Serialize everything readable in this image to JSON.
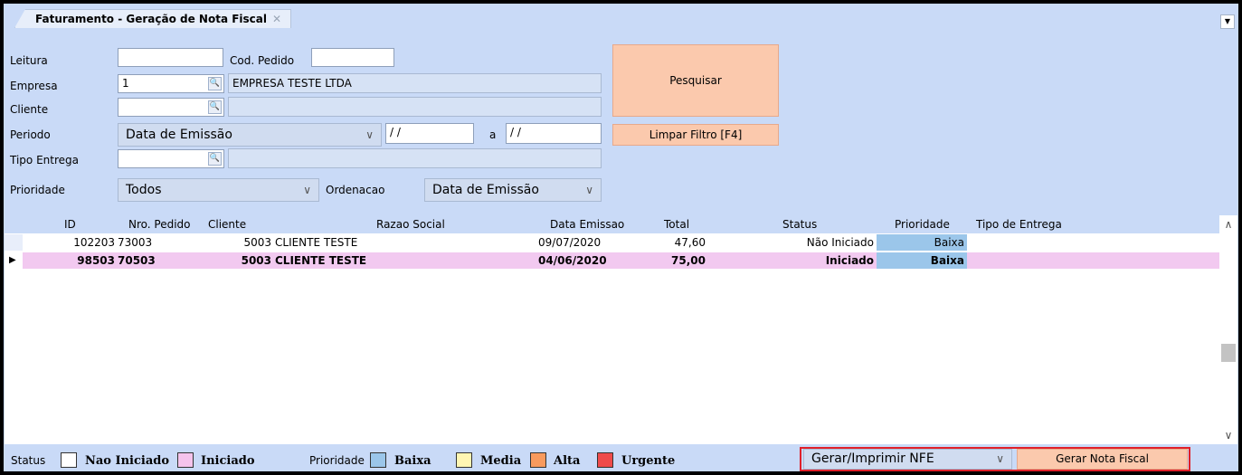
{
  "window": {
    "tab_title": "Faturamento - Geração de Nota Fiscal",
    "tab_close": "✕",
    "corner_glyph": "▼"
  },
  "filters": {
    "leitura_label": "Leitura",
    "leitura_value": "",
    "cod_pedido_label": "Cod. Pedido",
    "cod_pedido_value": "",
    "empresa_label": "Empresa",
    "empresa_code": "1",
    "empresa_name": "EMPRESA TESTE LTDA",
    "cliente_label": "Cliente",
    "cliente_code": "",
    "cliente_name": "",
    "periodo_label": "Periodo",
    "periodo_selected": "Data de Emissão",
    "date_from": " / /",
    "date_sep": "a",
    "date_to": " / /",
    "tipo_entrega_label": "Tipo Entrega",
    "tipo_entrega_code": "",
    "tipo_entrega_name": "",
    "prioridade_label": "Prioridade",
    "prioridade_selected": "Todos",
    "ordenacao_label": "Ordenacao",
    "ordenacao_selected": "Data de Emissão",
    "lens_glyph": "🔍",
    "dropdown_glyph": "∨"
  },
  "buttons": {
    "pesquisar": "Pesquisar",
    "limpar_filtro": "Limpar Filtro [F4]",
    "gerar_nota": "Gerar Nota Fiscal"
  },
  "grid": {
    "columns": [
      "ID",
      "Nro. Pedido",
      "Cliente",
      "Razao Social",
      "Data Emissao",
      "Total",
      "Status",
      "Prioridade",
      "Tipo de Entrega"
    ],
    "rows": [
      {
        "id": "102203",
        "nro_pedido": "73003",
        "cliente": "5003",
        "razao_social": "CLIENTE TESTE",
        "data_emissao": "09/07/2020",
        "total": "47,60",
        "status": "Não Iniciado",
        "prioridade": "Baixa",
        "tipo_entrega": ""
      },
      {
        "id": "98503",
        "nro_pedido": "70503",
        "cliente": "5003",
        "razao_social": "CLIENTE TESTE",
        "data_emissao": "04/06/2020",
        "total": "75,00",
        "status": "Iniciado",
        "prioridade": "Baixa",
        "tipo_entrega": ""
      }
    ],
    "selected_marker": "▶",
    "scroll_up": "∧",
    "scroll_down": "∨"
  },
  "legend": {
    "status_label": "Status",
    "nao_iniciado": "Nao Iniciado",
    "iniciado": "Iniciado",
    "prioridade_label": "Prioridade",
    "baixa": "Baixa",
    "media": "Media",
    "alta": "Alta",
    "urgente": "Urgente"
  },
  "action": {
    "selected": "Gerar/Imprimir NFE"
  },
  "colors": {
    "panel": "#c9daf7",
    "button": "#fbc9ad",
    "selected_row": "#f2c9f0",
    "priority_baixa": "#9bc6ea",
    "status_nao_iniciado": "#ffffff",
    "status_iniciado": "#f5c3ec",
    "priority_media": "#fff6b3",
    "priority_alta": "#f89a5d",
    "priority_urgente": "#ef4b4b",
    "highlight": "#e0202a"
  }
}
